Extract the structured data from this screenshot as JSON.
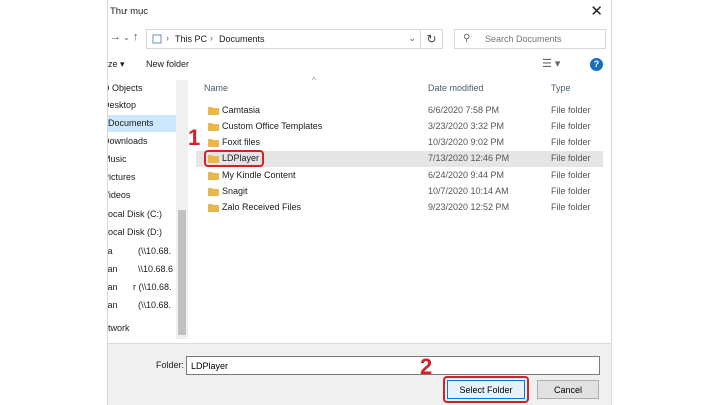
{
  "window": {
    "title": "Thư mục"
  },
  "address": {
    "crumbs": [
      "This PC",
      "Documents"
    ]
  },
  "search": {
    "placeholder": "Search Documents"
  },
  "toolbar": {
    "organize": "ize ▾",
    "new_folder": "New folder"
  },
  "nav_pane": {
    "items": [
      {
        "label": "D Objects",
        "extra": ""
      },
      {
        "label": "Desktop",
        "extra": ""
      },
      {
        "label": "Documents",
        "extra": ""
      },
      {
        "label": "Downloads",
        "extra": ""
      },
      {
        "label": "Music",
        "extra": ""
      },
      {
        "label": "Pictures",
        "extra": ""
      },
      {
        "label": "Videos",
        "extra": ""
      },
      {
        "label": "Local Disk (C:)",
        "extra": ""
      },
      {
        "label": "Local Disk (D:)",
        "extra": ""
      },
      {
        "label": "ca",
        "extra": "(\\\\10.68."
      },
      {
        "label": "can",
        "extra": "\\\\10.68.6"
      },
      {
        "label": "can",
        "extra": "r (\\\\10.68."
      },
      {
        "label": "can",
        "extra": "(\\\\10.68."
      },
      {
        "label": "etwork",
        "extra": ""
      }
    ]
  },
  "file_list": {
    "columns": {
      "name": "Name",
      "date": "Date modified",
      "type": "Type"
    },
    "rows": [
      {
        "name": "Camtasia",
        "date": "6/6/2020 7:58 PM",
        "type": "File folder"
      },
      {
        "name": "Custom Office Templates",
        "date": "3/23/2020 3:32 PM",
        "type": "File folder"
      },
      {
        "name": "Foxit files",
        "date": "10/3/2020 9:02 PM",
        "type": "File folder"
      },
      {
        "name": "LDPlayer",
        "date": "7/13/2020 12:46 PM",
        "type": "File folder"
      },
      {
        "name": "My Kindle Content",
        "date": "6/24/2020 9:44 PM",
        "type": "File folder"
      },
      {
        "name": "Snagit",
        "date": "10/7/2020 10:14 AM",
        "type": "File folder"
      },
      {
        "name": "Zalo Received Files",
        "date": "9/23/2020 12:52 PM",
        "type": "File folder"
      }
    ]
  },
  "footer": {
    "folder_label": "Folder:",
    "folder_value": "LDPlayer",
    "select_label": "Select Folder",
    "cancel_label": "Cancel"
  },
  "annotations": {
    "step1": "1",
    "step2": "2"
  },
  "colors": {
    "highlight": "#d42027",
    "selection": "#cce8ff",
    "folder": "#e8b84a"
  }
}
